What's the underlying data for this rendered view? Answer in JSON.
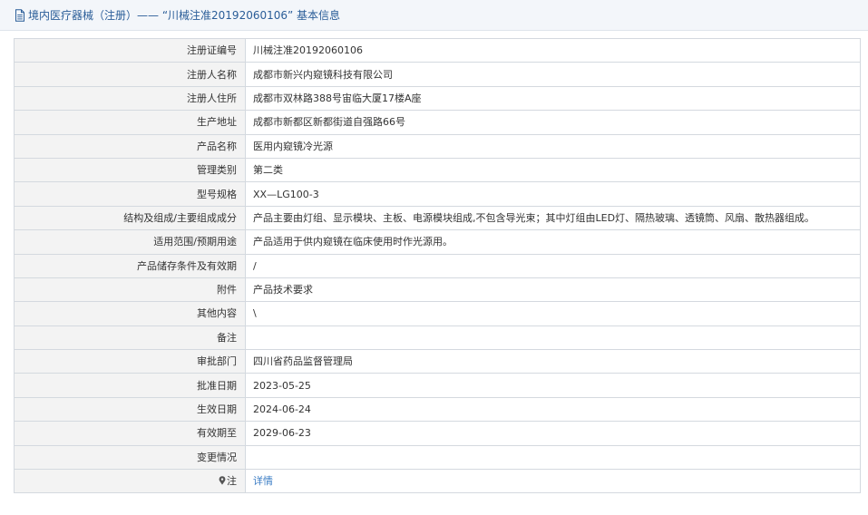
{
  "header": {
    "title": "境内医疗器械（注册）—— “川械注准20192060106” 基本信息",
    "icon": "document-icon",
    "color": "#2a5d98"
  },
  "rows": [
    {
      "label": "注册证编号",
      "value": "川械注准20192060106"
    },
    {
      "label": "注册人名称",
      "value": "成都市新兴内窥镜科技有限公司"
    },
    {
      "label": "注册人住所",
      "value": "成都市双林路388号宙临大厦17楼A座"
    },
    {
      "label": "生产地址",
      "value": "成都市新都区新都街道自强路66号"
    },
    {
      "label": "产品名称",
      "value": "医用内窥镜冷光源"
    },
    {
      "label": "管理类别",
      "value": "第二类"
    },
    {
      "label": "型号规格",
      "value": "XX—LG100-3"
    },
    {
      "label": "结构及组成/主要组成成分",
      "value": "产品主要由灯组、显示模块、主板、电源模块组成,不包含导光束；其中灯组由LED灯、隔热玻璃、透镜筒、风扇、散热器组成。"
    },
    {
      "label": "适用范围/预期用途",
      "value": "产品适用于供内窥镜在临床使用时作光源用。"
    },
    {
      "label": "产品储存条件及有效期",
      "value": "/"
    },
    {
      "label": "附件",
      "value": "产品技术要求"
    },
    {
      "label": "其他内容",
      "value": "\\"
    },
    {
      "label": "备注",
      "value": ""
    },
    {
      "label": "审批部门",
      "value": "四川省药品监督管理局"
    },
    {
      "label": "批准日期",
      "value": "2023-05-25"
    },
    {
      "label": "生效日期",
      "value": "2024-06-24"
    },
    {
      "label": "有效期至",
      "value": "2029-06-23"
    },
    {
      "label": "变更情况",
      "value": ""
    }
  ],
  "note_row": {
    "label": "注",
    "icon": "pin-icon",
    "link_text": "详情",
    "link_color": "#3a7cc4"
  }
}
